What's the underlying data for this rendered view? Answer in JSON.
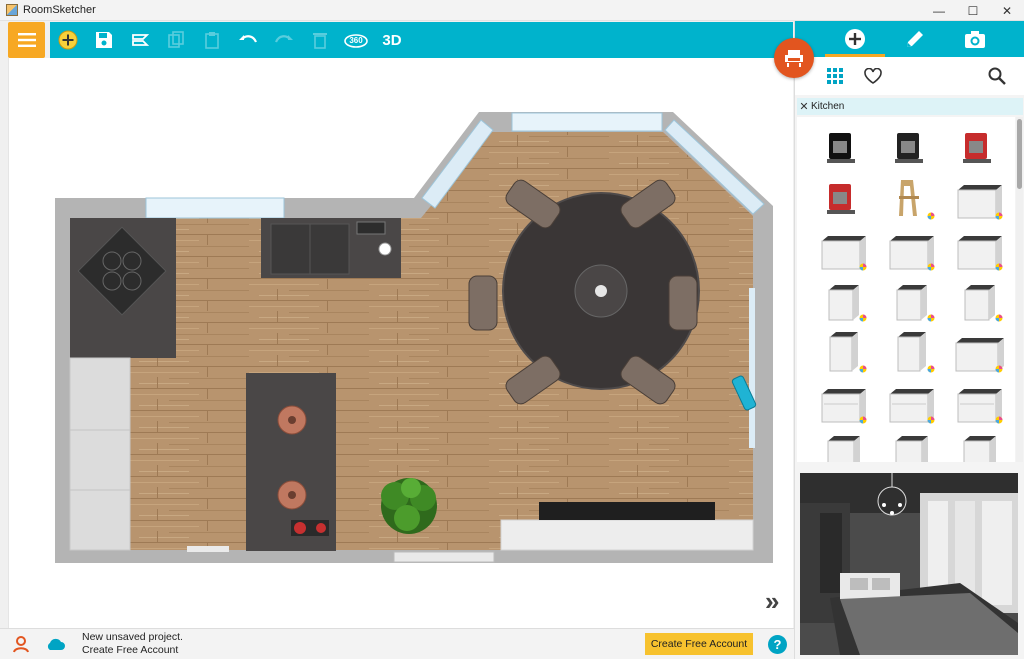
{
  "window": {
    "title": "RoomSketcher",
    "minimize": "—",
    "maximize": "☐",
    "close": "✕"
  },
  "toolbar": {
    "items": [
      {
        "name": "add-icon",
        "enabled": true
      },
      {
        "name": "save-icon",
        "enabled": true
      },
      {
        "name": "layers-icon",
        "enabled": true
      },
      {
        "name": "copy-icon",
        "enabled": false
      },
      {
        "name": "paste-icon",
        "enabled": false
      },
      {
        "name": "undo-icon",
        "enabled": true
      },
      {
        "name": "redo-icon",
        "enabled": false
      },
      {
        "name": "trash-icon",
        "enabled": false
      },
      {
        "name": "360-view-icon",
        "enabled": true
      }
    ],
    "view_360_label": "360",
    "view_3d_label": "3D"
  },
  "colors": {
    "toolbar": "#00b3cc",
    "accent": "#f7a823",
    "fab": "#e2551f",
    "create_account": "#f7c22e"
  },
  "right_panel": {
    "tabs": [
      {
        "name": "add-furniture-icon",
        "active": true
      },
      {
        "name": "pencil-icon",
        "active": false
      },
      {
        "name": "camera-icon",
        "active": false
      }
    ],
    "library_tools": [
      "grid-view-icon",
      "favorites-heart-icon",
      "search-icon"
    ],
    "category": "Kitchen",
    "items": [
      "coffee-machine-black",
      "coffee-machine-dark",
      "coffee-machine-red",
      "espresso-machine-red",
      "high-chair-wood",
      "base-cabinet",
      "base-cabinet",
      "base-cabinet",
      "base-cabinet",
      "base-cabinet-narrow",
      "base-cabinet-narrow",
      "base-cabinet-narrow",
      "base-cabinet-tall",
      "base-cabinet-tall",
      "base-cabinet-wide",
      "drawer-cabinet",
      "drawer-cabinet",
      "drawer-cabinet",
      "base-cabinet-small",
      "base-cabinet-small",
      "base-cabinet-small"
    ]
  },
  "canvas": {
    "expand_label": "»"
  },
  "status": {
    "line1": "New unsaved project.",
    "line2": "Create Free Account",
    "create_account_button": "Create Free Account",
    "help": "?"
  }
}
